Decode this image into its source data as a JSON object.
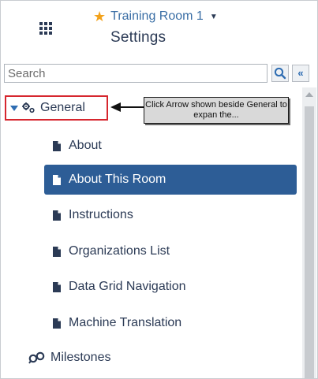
{
  "header": {
    "room_name": "Training Room 1",
    "page_title": "Settings",
    "icons": {
      "apps": "apps-grid-icon",
      "favorite": "star-icon",
      "room_menu": "caret-down-icon"
    },
    "colors": {
      "star": "#f3a21b",
      "title": "#2b3a55",
      "room": "#3a6ea5"
    }
  },
  "search": {
    "placeholder": "Search",
    "value": "",
    "icons": {
      "search": "search-icon",
      "collapse": "double-chevron-left-icon"
    }
  },
  "tree": {
    "general": {
      "label": "General",
      "expanded": true,
      "icon": "gears-icon"
    },
    "callout": {
      "text": "Click Arrow shown beside General to expan the..."
    },
    "items": [
      {
        "label": "About",
        "selected": false
      },
      {
        "label": "About This Room",
        "selected": true
      },
      {
        "label": "Instructions",
        "selected": false
      },
      {
        "label": "Organizations List",
        "selected": false
      },
      {
        "label": "Data Grid Navigation",
        "selected": false
      },
      {
        "label": "Machine Translation",
        "selected": false
      }
    ],
    "milestones": {
      "label": "Milestones",
      "icon": "milestones-icon"
    }
  },
  "theme": {
    "selected_bg": "#2d5d96",
    "highlight_border": "#d6262e",
    "accent": "#2f6db2"
  }
}
